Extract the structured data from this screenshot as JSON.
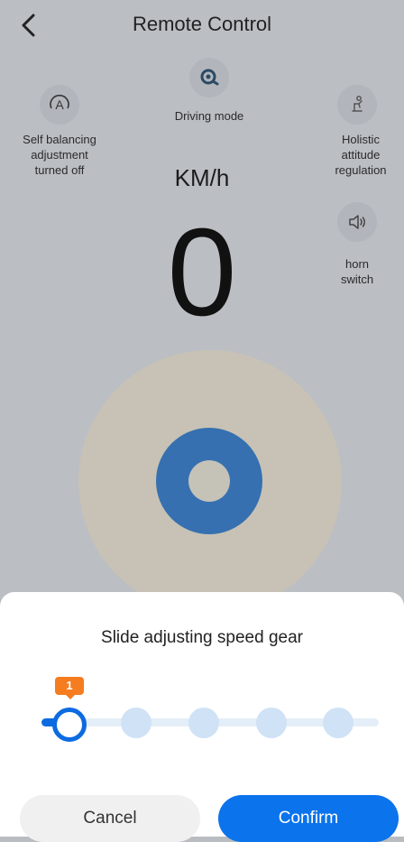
{
  "header": {
    "title": "Remote Control"
  },
  "driving_mode": {
    "label": "Driving mode",
    "icon": "driving-mode-icon"
  },
  "self_balancing": {
    "label": "Self balancing adjustment turned off",
    "icon": "auto-balance-icon"
  },
  "holistic": {
    "label": "Holistic attitude regulation",
    "icon": "seat-posture-icon"
  },
  "horn": {
    "label": "horn switch",
    "icon": "speaker-icon"
  },
  "speedometer": {
    "unit": "KM/h",
    "value": "0"
  },
  "gear_sheet": {
    "title": "Slide adjusting speed gear",
    "current_gear": "1",
    "gear_count": 5,
    "cancel_label": "Cancel",
    "confirm_label": "Confirm"
  },
  "colors": {
    "accent": "#0b73ec",
    "badge": "#f57c1f",
    "joystick": "#3670b0"
  }
}
